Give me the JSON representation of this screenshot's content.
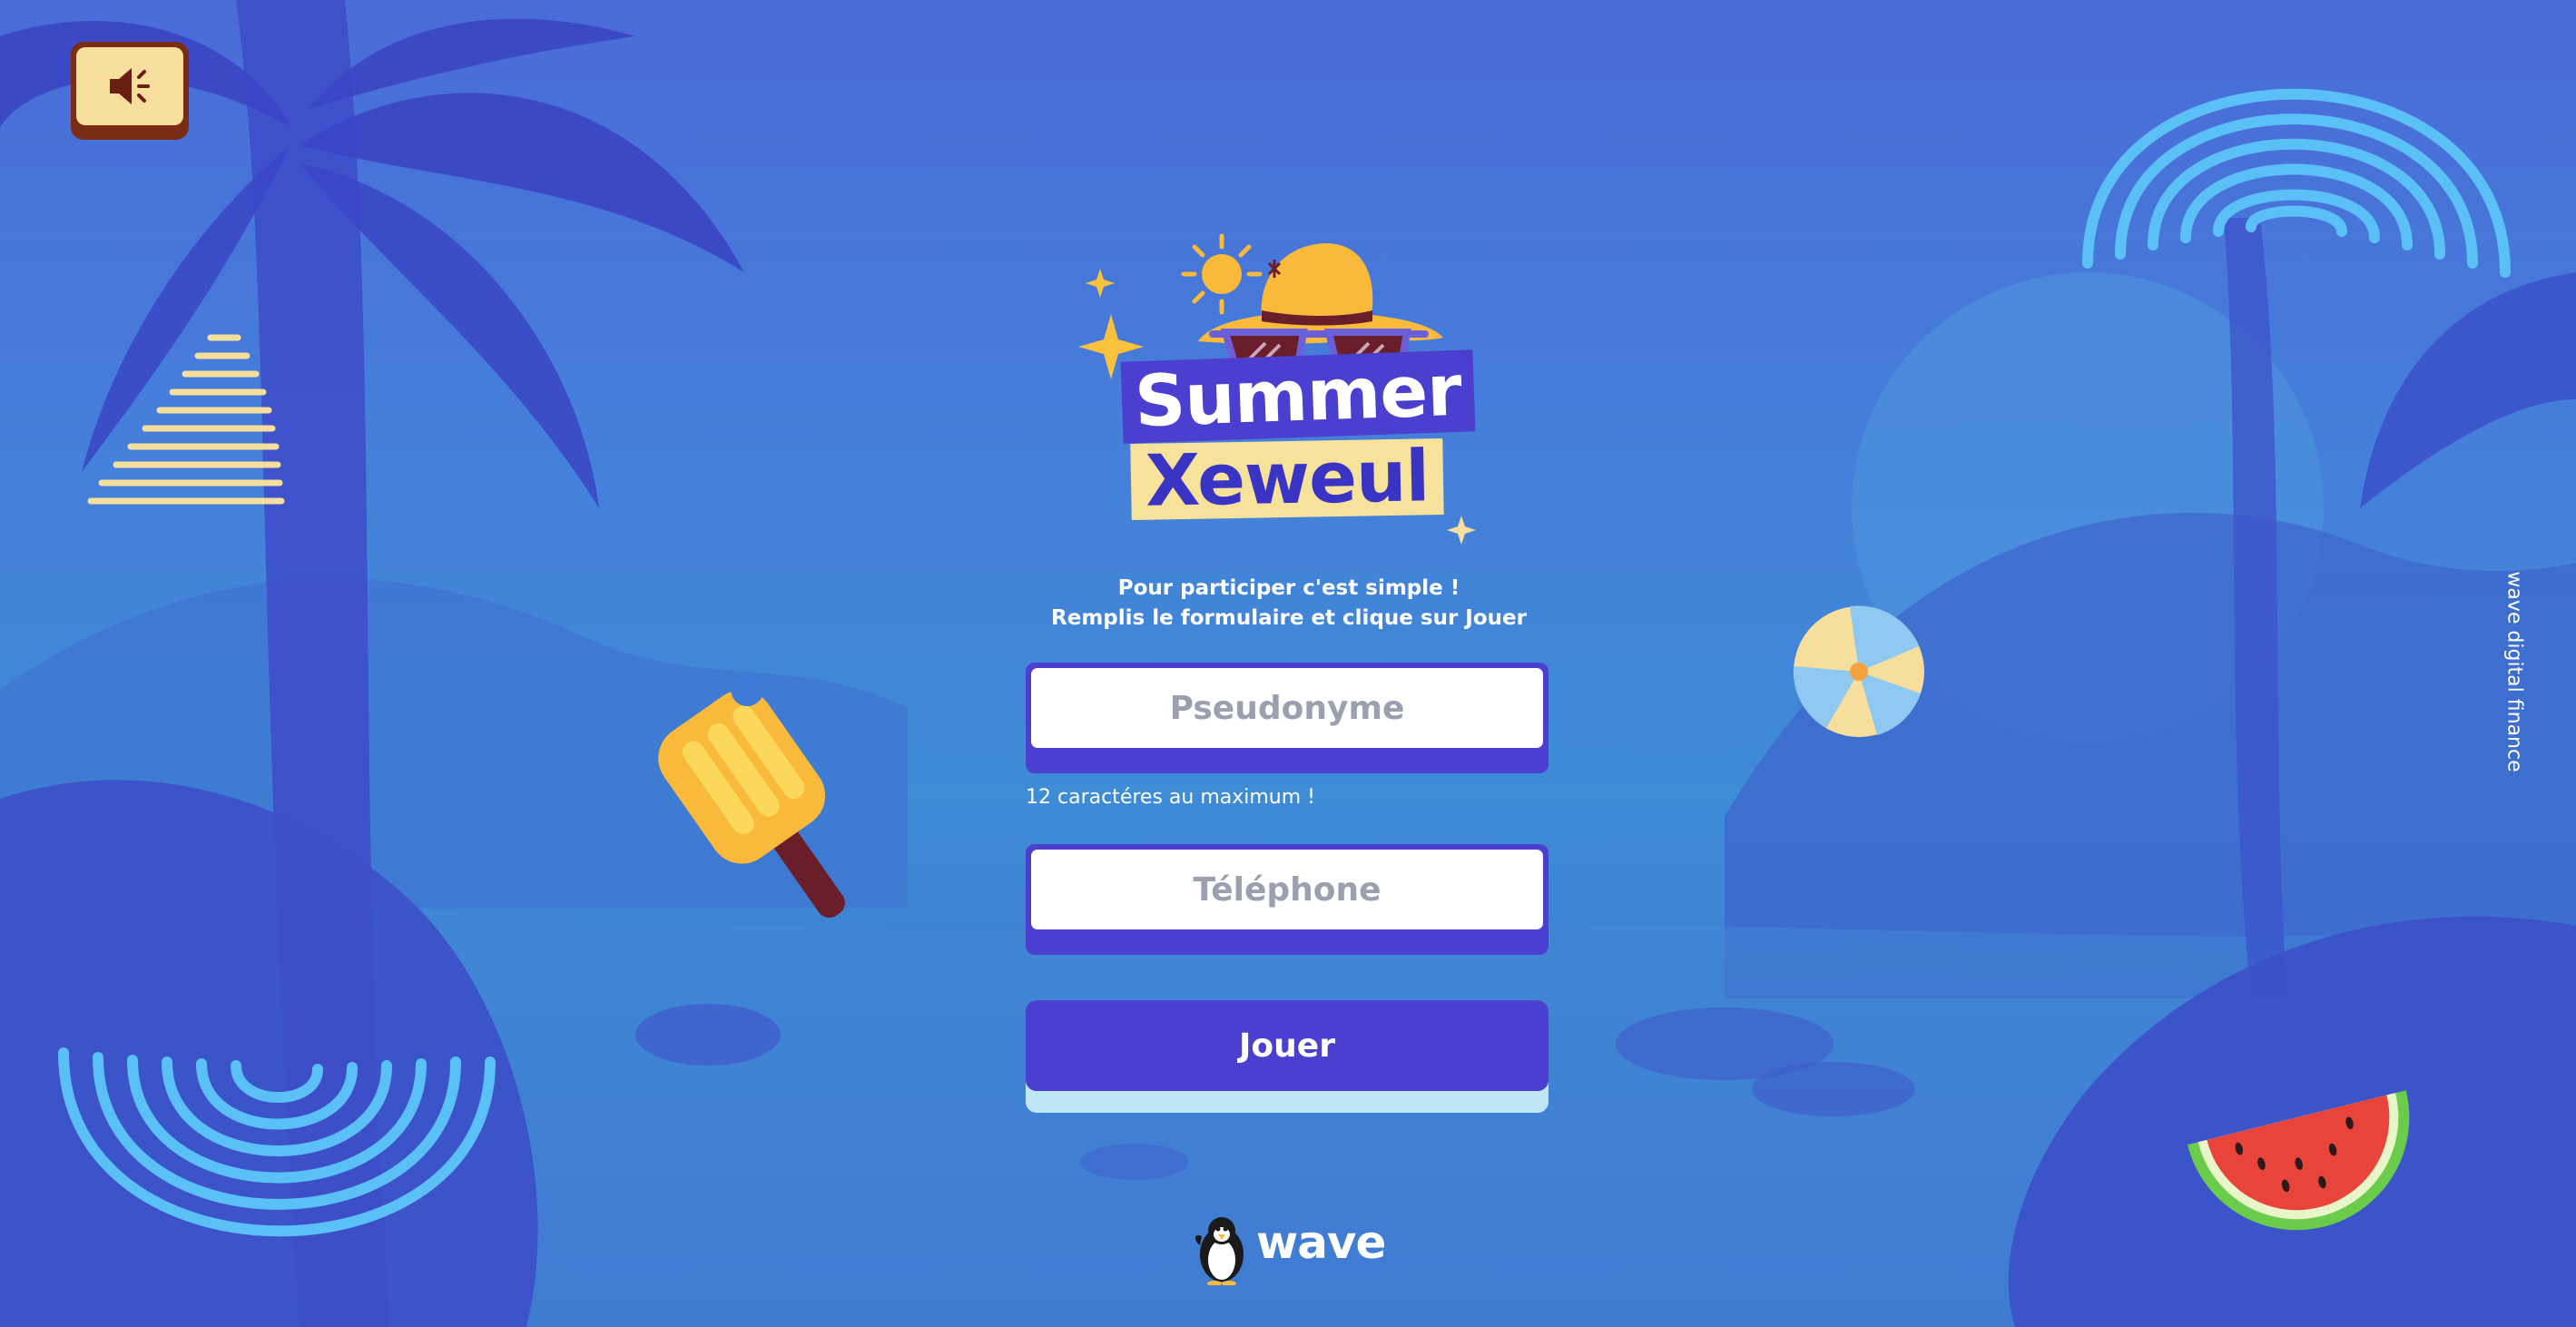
{
  "sound_button": {
    "icon": "speaker-icon"
  },
  "logo": {
    "line1": "Summer",
    "line2": "Xeweul"
  },
  "intro": {
    "line1": "Pour participer c'est simple !",
    "line2": "Remplis le formulaire et clique sur Jouer"
  },
  "form": {
    "pseudonym_placeholder": "Pseudonyme",
    "pseudonym_value": "",
    "pseudonym_hint": "12 caractéres au maximum !",
    "phone_placeholder": "Téléphone",
    "phone_value": "",
    "submit_label": "Jouer"
  },
  "brand": {
    "name": "wave",
    "mascot": "penguin-icon"
  },
  "side_tag": "wave digital finance",
  "colors": {
    "background": "#4580DA",
    "primary": "#4A3FCF",
    "cream": "#F6DE9C",
    "sound_button_dark": "#7A2C14",
    "button_shadow": "#BFE6F4"
  }
}
